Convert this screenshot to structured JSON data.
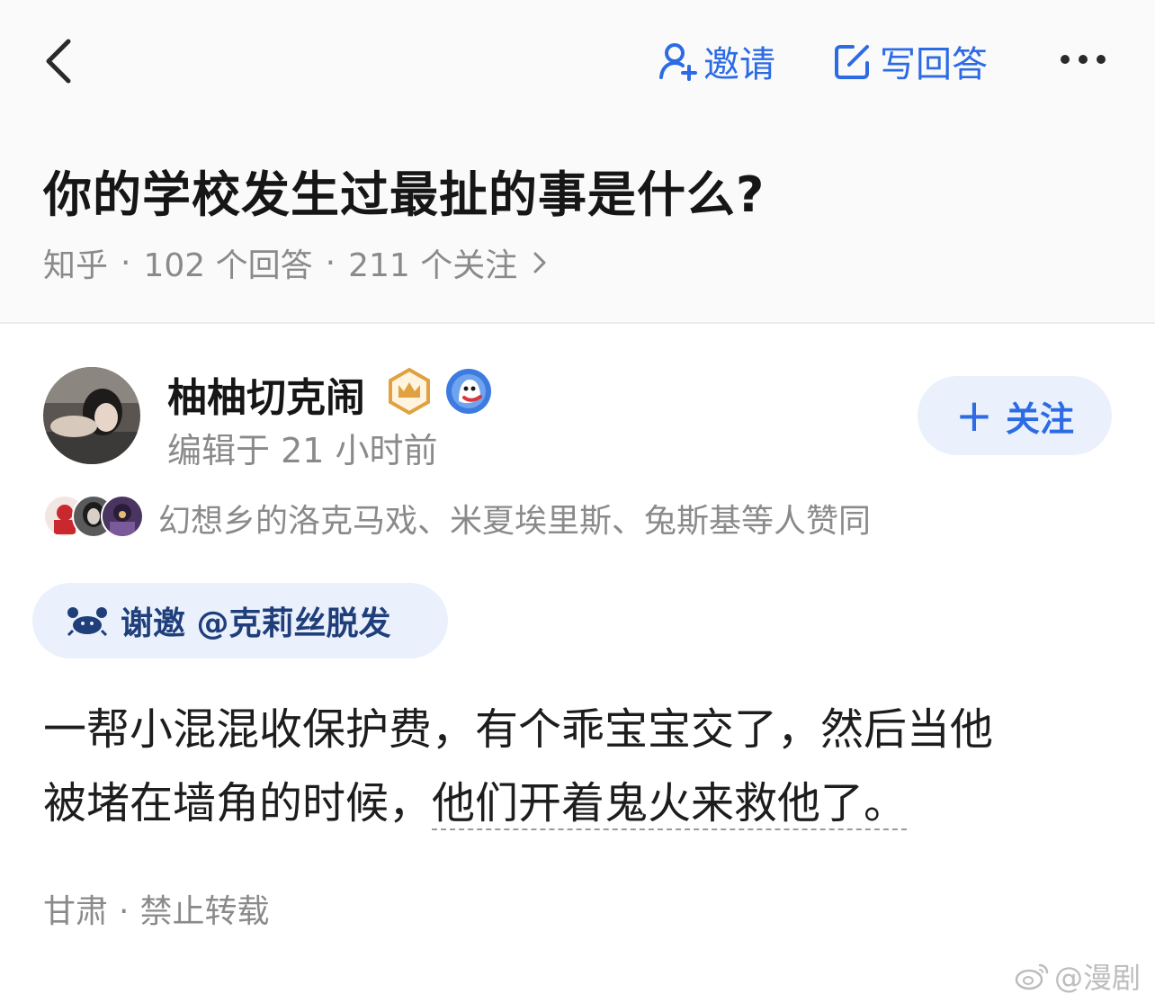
{
  "nav": {
    "invite_label": "邀请",
    "write_answer_label": "写回答",
    "accent_color": "#2d6be5"
  },
  "question": {
    "title": "你的学校发生过最扯的事是什么?",
    "source": "知乎",
    "answers_count": "102 个回答",
    "followers_count": "211 个关注"
  },
  "answer": {
    "author_name": "柚柚切克闹",
    "edited_time": "编辑于 21 小时前",
    "follow_label": "关注",
    "likers_text": "幻想乡的洛克马戏、米夏埃里斯、兔斯基等人赞同",
    "thanks_text": "谢邀 @克莉丝脱发",
    "body_line1": "一帮小混混收保护费，有个乖宝宝交了，然后当他",
    "body_line2_plain": "被堵在墙角的时候，",
    "body_line2_linked": "他们开着鬼火来救他了。",
    "location": "甘肃",
    "copyright": "禁止转载"
  },
  "watermark": {
    "text": "@漫剧"
  },
  "icons": [
    "back-icon",
    "user-plus-icon",
    "pencil-square-icon",
    "more-dots-icon",
    "chevron-right-icon",
    "crown-badge-icon",
    "ghost-badge-icon",
    "crab-icon",
    "weibo-logo-icon"
  ]
}
